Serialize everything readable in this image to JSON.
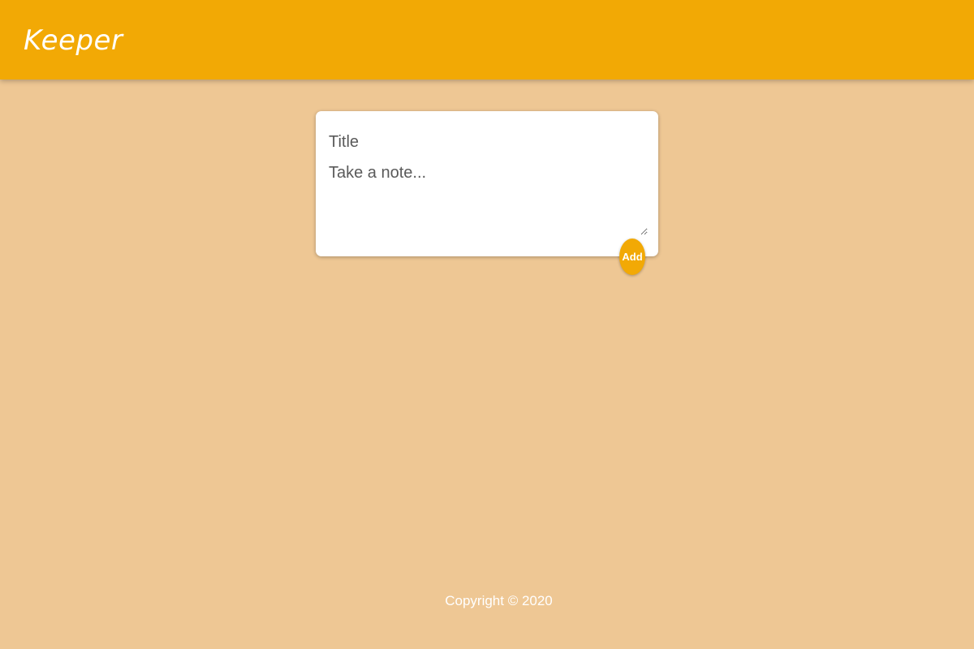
{
  "header": {
    "title": "Keeper"
  },
  "note_form": {
    "title_placeholder": "Title",
    "content_placeholder": "Take a note...",
    "add_label": "Add"
  },
  "footer": {
    "copyright": "Copyright © 2020"
  },
  "colors": {
    "background": "#eec794",
    "header": "#f2a905",
    "card": "#ffffff",
    "accent_button": "#f2a905"
  }
}
